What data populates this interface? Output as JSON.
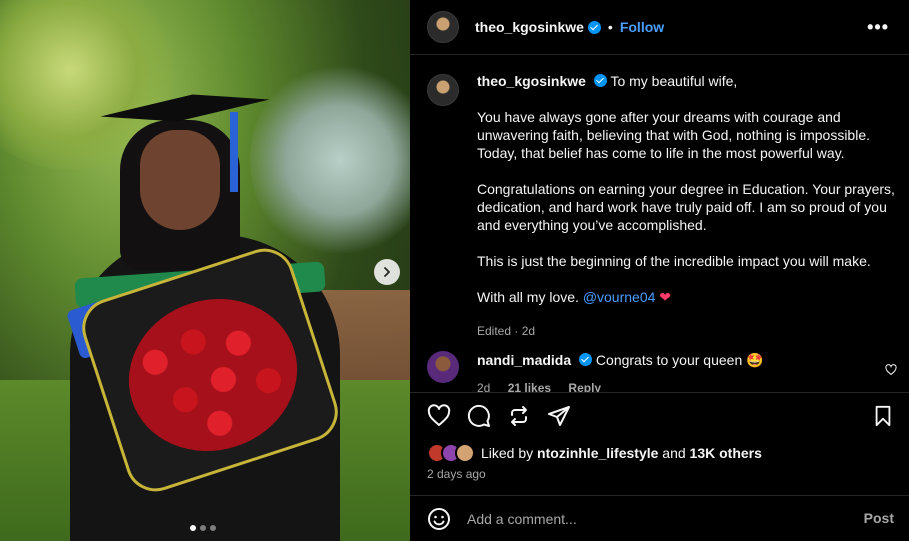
{
  "post": {
    "author": "theo_kgosinkwe",
    "follow_label": "Follow",
    "separator": "•",
    "more_label": "•••",
    "caption_author": "theo_kgosinkwe",
    "caption_lines": [
      "To my beautiful wife,",
      "You have always gone after your dreams with courage and unwavering faith, believing that with God, nothing is impossible. Today, that belief has come to life in the most powerful way.",
      "Congratulations on earning your degree in Education. Your prayers, dedication, and hard work have truly paid off. I am so proud of you and everything you’ve accomplished.",
      "This is just the beginning of the incredible impact you will make."
    ],
    "closing_text": "With all my love.",
    "closing_mention": "@vourne04",
    "closing_emoji": "❤",
    "caption_meta": "Edited · 2d"
  },
  "comments": [
    {
      "author": "nandi_madida",
      "text": "Congrats to your queen 🤩",
      "time": "2d",
      "likes": "21 likes",
      "reply": "Reply"
    }
  ],
  "likes": {
    "prefix": "Liked by",
    "user": "ntozinhle_lifestyle",
    "and": "and",
    "others": "13K others"
  },
  "time_ago": "2 days ago",
  "composer": {
    "placeholder": "Add a comment...",
    "post_label": "Post"
  },
  "carousel": {
    "slide_count": 3,
    "active_index": 0
  },
  "colors": {
    "accent": "#4a9eff",
    "verified": "#0095f6",
    "background": "#000000",
    "text": "#f5f5f5",
    "muted": "#a8a8a8"
  },
  "icons": [
    "heart-icon",
    "comment-icon",
    "repost-icon",
    "share-icon",
    "bookmark-icon",
    "emoji-icon",
    "chevron-right-icon",
    "more-icon",
    "verified-icon"
  ]
}
